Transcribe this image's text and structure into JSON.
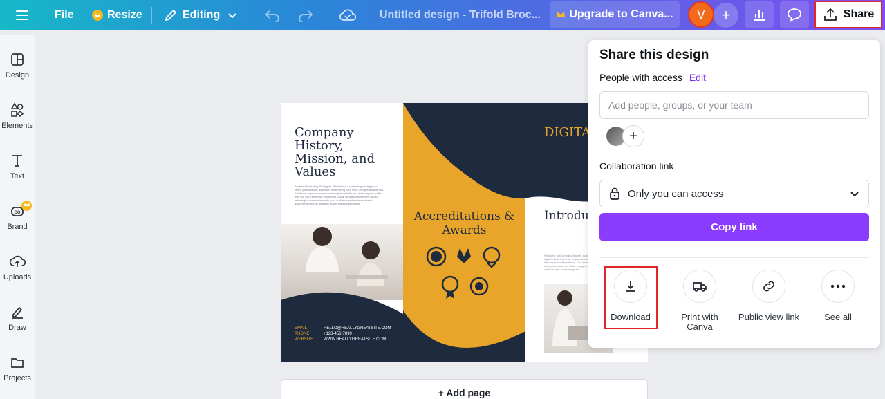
{
  "topbar": {
    "menu_icon": "hamburger-icon",
    "file_label": "File",
    "resize_label": "Resize",
    "editing_label": "Editing",
    "design_title": "Untitled design - Trifold Broc...",
    "upgrade_label": "Upgrade to Canva...",
    "avatar_initial": "V",
    "share_label": "Share",
    "accent_color": "#7b4ff0"
  },
  "sidebar": {
    "items": [
      {
        "label": "Design",
        "icon": "layout-icon"
      },
      {
        "label": "Elements",
        "icon": "shapes-icon"
      },
      {
        "label": "Text",
        "icon": "text-icon"
      },
      {
        "label": "Brand",
        "icon": "brand-icon"
      },
      {
        "label": "Uploads",
        "icon": "cloud-upload-icon"
      },
      {
        "label": "Draw",
        "icon": "pen-icon"
      },
      {
        "label": "Projects",
        "icon": "folder-icon"
      }
    ]
  },
  "brochure": {
    "panel1_title": "Company History, Mission, and Values",
    "panel1_bullets": "Targeted Marketing Strategies: We tailor our marketing strategies to reach your specific audience, maximizing your ROI. Comprehensive SEO Solutions: Improve your search engine visibility and drive organic traffic with our SEO expertise. Engaging Social Media Management: Build meaningful connections with your audience and enhance brand awareness through strategic social media campaigns.",
    "contact": [
      {
        "key": "EMAIL",
        "value": "HELLO@REALLYGREATSITE.COM"
      },
      {
        "key": "PHONE",
        "value": "+123-456-7890"
      },
      {
        "key": "WEBSITE",
        "value": "WWW.REALLYGREATSITE.COM"
      }
    ],
    "panel2_title": "Accreditations & Awards",
    "panel3_title": "DIGITA MARKE SOLUT",
    "panel3_heading": "Introdu to the Compar",
    "panel3_body": "Welcome to [Company Name], journey in digital marketing team of passionate expert helping businesses thrive. Our innovative strategies presence, drive engagement, and achieve their business goals.",
    "navy": "#1e2a3d",
    "gold": "#e9a52a"
  },
  "canvas": {
    "add_page_label": "+ Add page"
  },
  "share_panel": {
    "title": "Share this design",
    "people_label": "People with access",
    "edit_label": "Edit",
    "add_people_placeholder": "Add people, groups, or your team",
    "collab_label": "Collaboration link",
    "access_value": "Only you can access",
    "copy_link_label": "Copy link",
    "copy_link_color": "#8b3dff",
    "actions": [
      {
        "label": "Download",
        "icon": "download-icon"
      },
      {
        "label": "Print with Canva",
        "icon": "truck-icon"
      },
      {
        "label": "Public view link",
        "icon": "link-icon"
      },
      {
        "label": "See all",
        "icon": "more-icon"
      }
    ]
  }
}
